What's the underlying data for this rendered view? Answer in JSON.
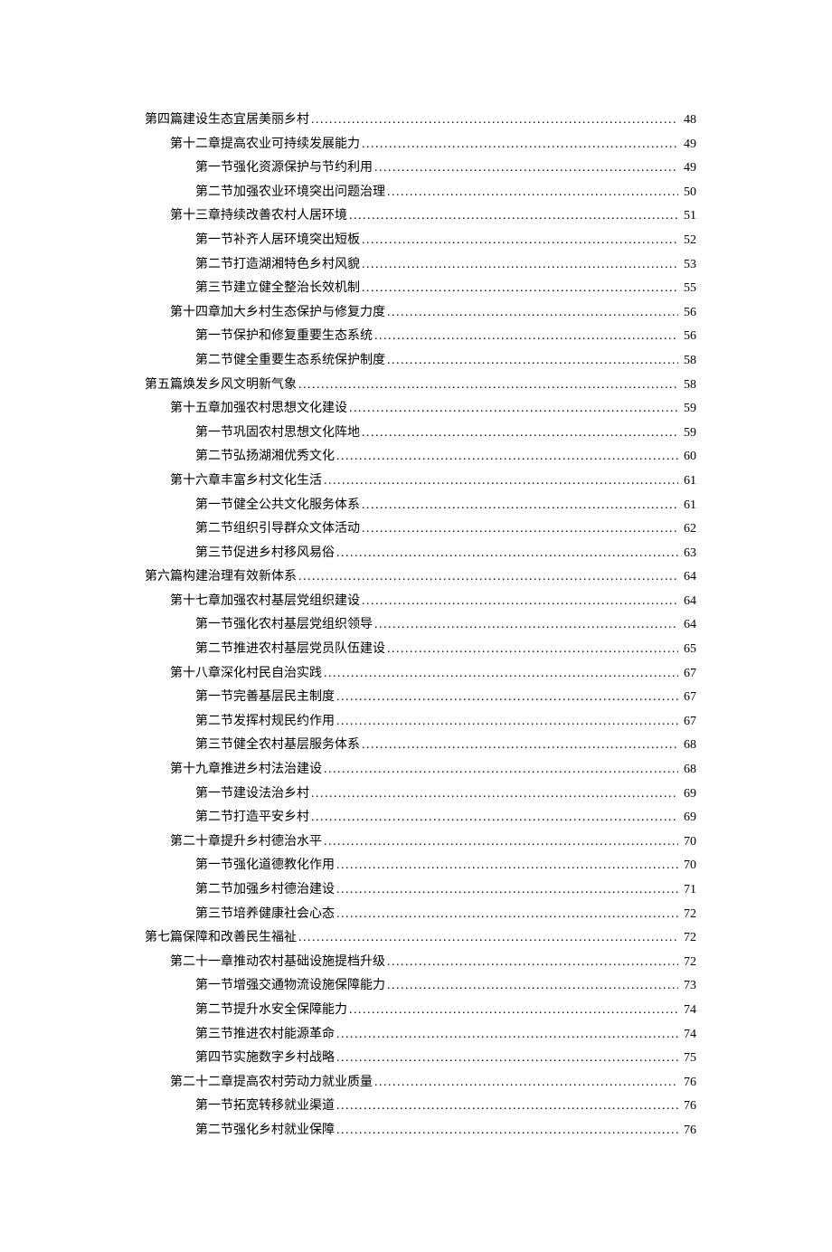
{
  "toc": [
    {
      "level": 1,
      "title": "第四篇建设生态宜居美丽乡村",
      "page": "48"
    },
    {
      "level": 2,
      "title": "第十二章提高农业可持续发展能力",
      "page": "49"
    },
    {
      "level": 3,
      "title": "第一节强化资源保护与节约利用",
      "page": "49"
    },
    {
      "level": 3,
      "title": "第二节加强农业环境突出问题治理",
      "page": "50"
    },
    {
      "level": 2,
      "title": "第十三章持续改善农村人居环境",
      "page": "51"
    },
    {
      "level": 3,
      "title": "第一节补齐人居环境突出短板",
      "page": "52"
    },
    {
      "level": 3,
      "title": "第二节打造湖湘特色乡村风貌",
      "page": "53"
    },
    {
      "level": 3,
      "title": "第三节建立健全整治长效机制",
      "page": "55"
    },
    {
      "level": 2,
      "title": "第十四章加大乡村生态保护与修复力度",
      "page": "56"
    },
    {
      "level": 3,
      "title": "第一节保护和修复重要生态系统",
      "page": "56"
    },
    {
      "level": 3,
      "title": "第二节健全重要生态系统保护制度",
      "page": "58"
    },
    {
      "level": 1,
      "title": "第五篇焕发乡风文明新气象",
      "page": "58"
    },
    {
      "level": 2,
      "title": "第十五章加强农村思想文化建设",
      "page": "59"
    },
    {
      "level": 3,
      "title": "第一节巩固农村思想文化阵地",
      "page": "59"
    },
    {
      "level": 3,
      "title": "第二节弘扬湖湘优秀文化",
      "page": "60"
    },
    {
      "level": 2,
      "title": "第十六章丰富乡村文化生活",
      "page": "61"
    },
    {
      "level": 3,
      "title": "第一节健全公共文化服务体系",
      "page": "61"
    },
    {
      "level": 3,
      "title": "第二节组织引导群众文体活动",
      "page": "62"
    },
    {
      "level": 3,
      "title": "第三节促进乡村移风易俗",
      "page": "63"
    },
    {
      "level": 1,
      "title": "第六篇构建治理有效新体系",
      "page": "64"
    },
    {
      "level": 2,
      "title": "第十七章加强农村基层党组织建设",
      "page": "64"
    },
    {
      "level": 3,
      "title": "第一节强化农村基层党组织领导",
      "page": "64"
    },
    {
      "level": 3,
      "title": "第二节推进农村基层党员队伍建设",
      "page": "65"
    },
    {
      "level": 2,
      "title": "第十八章深化村民自治实践",
      "page": "67"
    },
    {
      "level": 3,
      "title": "第一节完善基层民主制度",
      "page": "67"
    },
    {
      "level": 3,
      "title": "第二节发挥村规民约作用",
      "page": "67"
    },
    {
      "level": 3,
      "title": "第三节健全农村基层服务体系",
      "page": "68"
    },
    {
      "level": 2,
      "title": "第十九章推进乡村法治建设",
      "page": "68"
    },
    {
      "level": 3,
      "title": "第一节建设法治乡村",
      "page": "69"
    },
    {
      "level": 3,
      "title": "第二节打造平安乡村",
      "page": "69"
    },
    {
      "level": 2,
      "title": "第二十章提升乡村德治水平",
      "page": "70"
    },
    {
      "level": 3,
      "title": "第一节强化道德教化作用",
      "page": "70"
    },
    {
      "level": 3,
      "title": "第二节加强乡村德治建设",
      "page": "71"
    },
    {
      "level": 3,
      "title": "第三节培养健康社会心态",
      "page": "72"
    },
    {
      "level": 1,
      "title": "第七篇保障和改善民生福祉",
      "page": "72"
    },
    {
      "level": 2,
      "title": "第二十一章推动农村基础设施提档升级",
      "page": "72"
    },
    {
      "level": 3,
      "title": "第一节增强交通物流设施保障能力",
      "page": "73"
    },
    {
      "level": 3,
      "title": "第二节提升水安全保障能力",
      "page": "74"
    },
    {
      "level": 3,
      "title": "第三节推进农村能源革命",
      "page": "74"
    },
    {
      "level": 3,
      "title": "第四节实施数字乡村战略",
      "page": "75"
    },
    {
      "level": 2,
      "title": "第二十二章提高农村劳动力就业质量",
      "page": "76"
    },
    {
      "level": 3,
      "title": "第一节拓宽转移就业渠道",
      "page": "76"
    },
    {
      "level": 3,
      "title": "第二节强化乡村就业保障",
      "page": "76"
    }
  ]
}
